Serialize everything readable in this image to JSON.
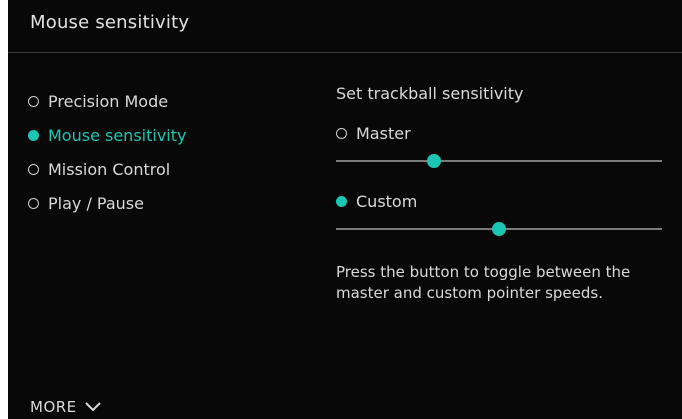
{
  "header": {
    "title": "Mouse sensitivity"
  },
  "buttons": [
    {
      "label": "Precision Mode",
      "selected": false
    },
    {
      "label": "Mouse sensitivity",
      "selected": true
    },
    {
      "label": "Mission Control",
      "selected": false
    },
    {
      "label": "Play / Pause",
      "selected": false
    }
  ],
  "sensitivity": {
    "title": "Set trackball sensitivity",
    "master": {
      "label": "Master",
      "selected": false,
      "value_fraction": 0.3
    },
    "custom": {
      "label": "Custom",
      "selected": true,
      "value_fraction": 0.5
    },
    "help_text": "Press the button to toggle between the master and custom pointer speeds."
  },
  "footer": {
    "more_label": "MORE",
    "more_icon": "chevron-down-icon"
  },
  "colors": {
    "accent": "#19c6b4",
    "background": "#080808",
    "text": "#d9d9d9"
  }
}
